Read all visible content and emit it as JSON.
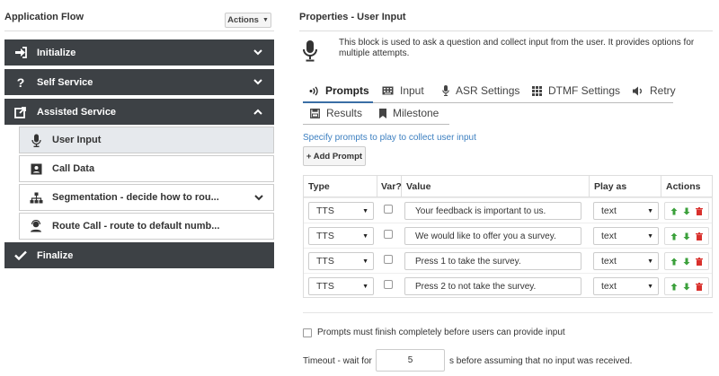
{
  "left": {
    "title": "Application Flow",
    "actions_label": "Actions",
    "groups": [
      {
        "label": "Initialize",
        "icon": "sign-in-icon",
        "expanded": false
      },
      {
        "label": "Self Service",
        "icon": "question-icon",
        "expanded": false
      },
      {
        "label": "Assisted Service",
        "icon": "share-icon",
        "expanded": true
      },
      {
        "label": "Finalize",
        "icon": "check-icon",
        "expanded": false
      }
    ],
    "assisted_items": [
      {
        "label": "User Input",
        "icon": "microphone-icon",
        "selected": true
      },
      {
        "label": "Call Data",
        "icon": "id-card-icon",
        "selected": false
      },
      {
        "label": "Segmentation - decide how to rou...",
        "icon": "sitemap-icon",
        "selected": false
      },
      {
        "label": "Route Call - route to default numb...",
        "icon": "agent-icon",
        "selected": false
      }
    ]
  },
  "right": {
    "title": "Properties - User Input",
    "description": "This block is used to ask a question and collect input from the user. It provides options for multiple attempts.",
    "tabs": [
      {
        "label": "Prompts",
        "icon": "voice-icon",
        "active": true
      },
      {
        "label": "Input",
        "icon": "keyboard-icon",
        "active": false
      },
      {
        "label": "ASR Settings",
        "icon": "microphone-icon",
        "active": false
      },
      {
        "label": "DTMF Settings",
        "icon": "keypad-icon",
        "active": false
      },
      {
        "label": "Retry",
        "icon": "speaker-icon",
        "active": false
      },
      {
        "label": "Results",
        "icon": "save-icon",
        "active": false
      },
      {
        "label": "Milestone",
        "icon": "bookmark-icon",
        "active": false
      }
    ],
    "prompts_link": "Specify prompts to play to collect user input",
    "add_prompt": "+ Add Prompt",
    "table": {
      "headers": [
        "Type",
        "Var?",
        "Value",
        "Play as",
        "Actions"
      ],
      "rows": [
        {
          "type": "TTS",
          "var": false,
          "value": "Your feedback is important to us.",
          "play_as": "text"
        },
        {
          "type": "TTS",
          "var": false,
          "value": "We would like to offer you a survey.",
          "play_as": "text"
        },
        {
          "type": "TTS",
          "var": false,
          "value": "Press 1 to take the survey.",
          "play_as": "text"
        },
        {
          "type": "TTS",
          "var": false,
          "value": "Press 2 to not take the survey.",
          "play_as": "text"
        }
      ]
    },
    "must_finish_label": "Prompts must finish completely before users can provide input",
    "must_finish_checked": false,
    "timeout_label": "Timeout - wait for",
    "timeout_value": "5",
    "timeout_suffix": "s before assuming that no input was received."
  },
  "colors": {
    "group_header_bg": "#3d4145",
    "selected_item_bg": "#e6e9ed",
    "link": "#3c7fc0",
    "tab_active": "#3a6ea5",
    "arrow_green": "#3ba03b",
    "trash_red": "#d9302c"
  }
}
